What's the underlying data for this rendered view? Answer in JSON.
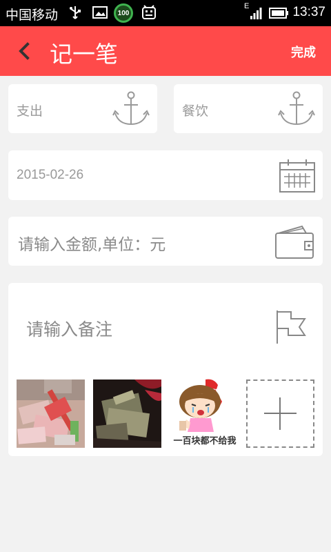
{
  "status_bar": {
    "carrier": "中国移动",
    "battery_badge": "100",
    "network_type": "E",
    "time": "13:37",
    "icons": [
      "usb-icon",
      "image-icon",
      "battery-saver-icon",
      "android-icon",
      "signal-icon",
      "battery-icon"
    ]
  },
  "header": {
    "title": "记一笔",
    "done_label": "完成",
    "background_color": "#ff4a4a"
  },
  "form": {
    "type_value": "支出",
    "category_value": "餐饮",
    "date_value": "2015-02-26",
    "amount_placeholder": "请输入金额,单位：元",
    "note_placeholder": "请输入备注"
  },
  "photos": {
    "caption": "一百块都不给我",
    "icons": [
      "photo-money-broom",
      "photo-money-dark",
      "sticker-crying-girl",
      "add-photo-icon"
    ]
  }
}
